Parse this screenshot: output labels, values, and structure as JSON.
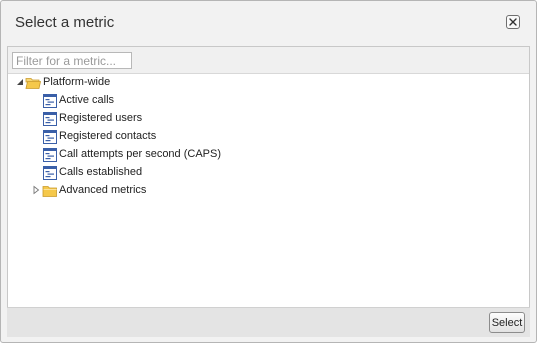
{
  "dialog": {
    "title": "Select a metric",
    "close_icon": "close-icon"
  },
  "filter": {
    "placeholder": "Filter for a metric...",
    "value": ""
  },
  "tree": {
    "root": {
      "label": "Platform-wide",
      "icon": "folder-open-icon",
      "expanded": true,
      "children": [
        {
          "label": "Active calls",
          "icon": "metric-icon"
        },
        {
          "label": "Registered users",
          "icon": "metric-icon"
        },
        {
          "label": "Registered contacts",
          "icon": "metric-icon"
        },
        {
          "label": "Call attempts per second (CAPS)",
          "icon": "metric-icon"
        },
        {
          "label": "Calls established",
          "icon": "metric-icon"
        },
        {
          "label": "Advanced metrics",
          "icon": "folder-closed-icon",
          "expanded": false
        }
      ]
    }
  },
  "footer": {
    "select_label": "Select"
  },
  "colors": {
    "folder": "#f5c84a",
    "metric_icon": "#3a5fa8",
    "dialog_bg": "#f2f2f2",
    "footer_bg": "#e4e4e4"
  }
}
